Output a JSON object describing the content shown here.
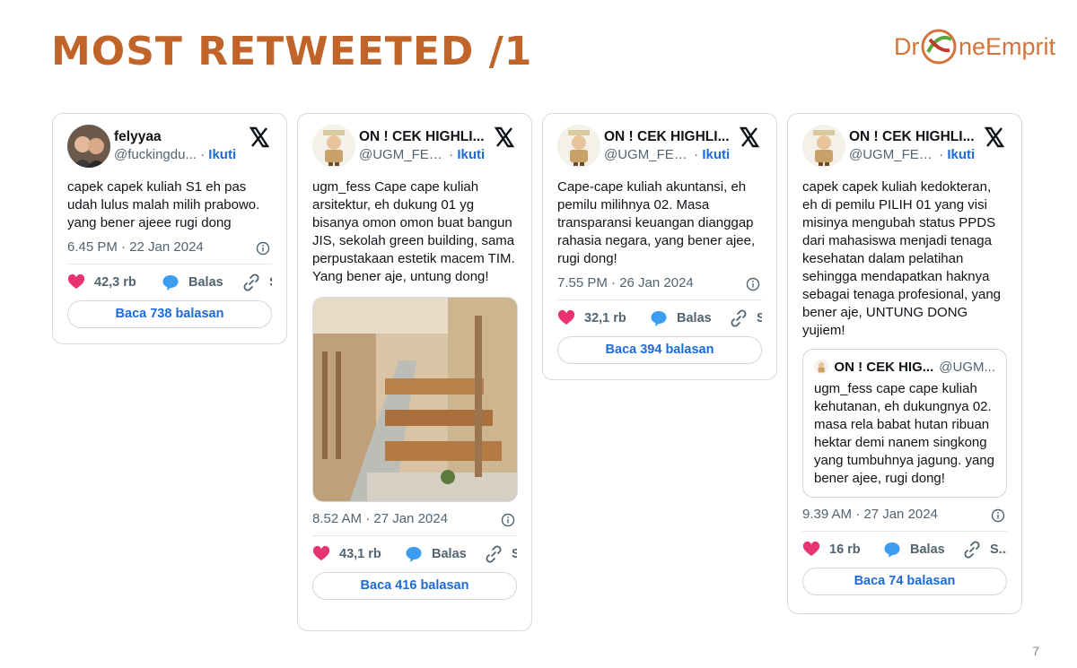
{
  "slide": {
    "title": "MOST RETWEETED /1",
    "brand": "Dr  neEmprit",
    "page_number": "7"
  },
  "tweets": [
    {
      "author": "felyyaa",
      "handle": "@fuckingdu...",
      "follow": "Ikuti",
      "text": "capek capek kuliah S1 eh pas udah lulus malah milih prabowo. yang bener ajeee rugi dong",
      "time": "6.45 PM · 22 Jan 2024",
      "likes": "42,3 rb",
      "reply_label": "Balas",
      "share_label": "S",
      "read_replies": "Baca 738 balasan"
    },
    {
      "author": "ON ! CEK HIGHLI...",
      "handle": "@UGM_FESS",
      "follow": "Ikuti",
      "text": "ugm_fess Cape cape kuliah arsitektur, eh dukung 01 yg bisanya omon omon buat bangun JIS, sekolah green building, sama perpustakaan estetik macem TIM. Yang bener aje, untung dong!",
      "time": "8.52 AM · 27 Jan 2024",
      "likes": "43,1 rb",
      "reply_label": "Balas",
      "share_label": "S",
      "read_replies": "Baca 416 balasan"
    },
    {
      "author": "ON ! CEK HIGHLI...",
      "handle": "@UGM_FESS",
      "follow": "Ikuti",
      "text": "Cape-cape kuliah akuntansi, eh pemilu milihnya 02. Masa transparansi keuangan dianggap rahasia negara, yang bener ajee, rugi dong!",
      "time": "7.55 PM · 26 Jan 2024",
      "likes": "32,1 rb",
      "reply_label": "Balas",
      "share_label": "S",
      "read_replies": "Baca 394 balasan"
    },
    {
      "author": "ON ! CEK HIGHLI...",
      "handle": "@UGM_FESS",
      "follow": "Ikuti",
      "text": "capek capek kuliah kedokteran, eh di pemilu PILIH 01 yang visi misinya mengubah status PPDS dari mahasiswa menjadi tenaga kesehatan dalam pelatihan sehingga mendapatkan haknya sebagai tenaga profesional, yang bener aje, UNTUNG DONG yujiem!",
      "quote_author": "ON ! CEK HIG...",
      "quote_handle": "@UGM...",
      "quote_text": "ugm_fess cape cape kuliah kehutanan, eh dukungnya 02. masa rela babat hutan ribuan hektar demi nanem singkong yang tumbuhnya jagung. yang bener ajee, rugi dong!",
      "time": "9.39 AM · 27 Jan 2024",
      "likes": "16 rb",
      "reply_label": "Balas",
      "share_label": "S...",
      "read_replies": "Baca 74 balasan"
    }
  ],
  "colors": {
    "title": "#c0642a",
    "link": "#1d6bd8",
    "like": "#e8336f",
    "reply": "#3b9cf2"
  }
}
